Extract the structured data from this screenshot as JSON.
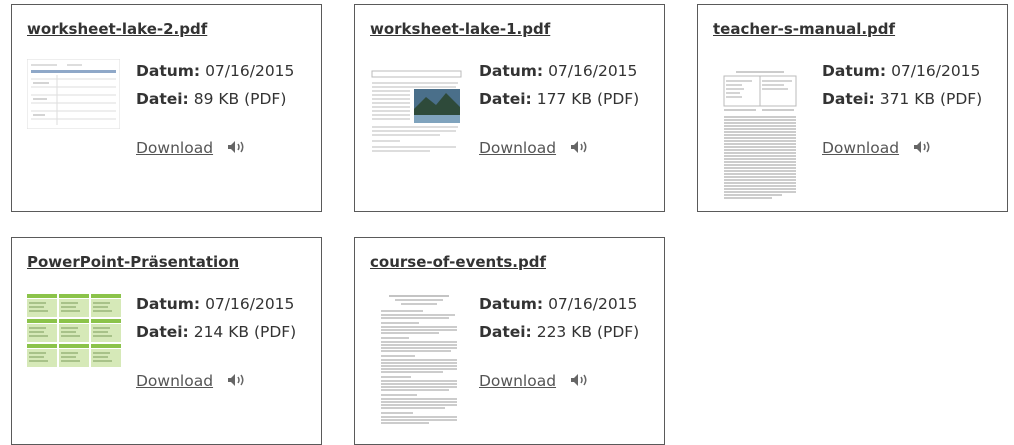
{
  "labels": {
    "date_label": "Datum:",
    "file_label": "Datei:",
    "download_label": "Download"
  },
  "files": [
    {
      "title": "worksheet-lake-2.pdf",
      "date": "07/16/2015",
      "size": "89 KB (PDF)"
    },
    {
      "title": "worksheet-lake-1.pdf",
      "date": "07/16/2015",
      "size": "177 KB (PDF)"
    },
    {
      "title": "teacher-s-manual.pdf",
      "date": "07/16/2015",
      "size": "371 KB (PDF)"
    },
    {
      "title": "PowerPoint-Präsentation",
      "date": "07/16/2015",
      "size": "214 KB (PDF)"
    },
    {
      "title": "course-of-events.pdf",
      "date": "07/16/2015",
      "size": "223 KB (PDF)"
    }
  ],
  "colors": {
    "border": "#5a5a5a",
    "text": "#333333",
    "speaker": "#666666",
    "slide_green": "#8bc34a"
  },
  "icons": {
    "audio": "speaker-icon"
  }
}
